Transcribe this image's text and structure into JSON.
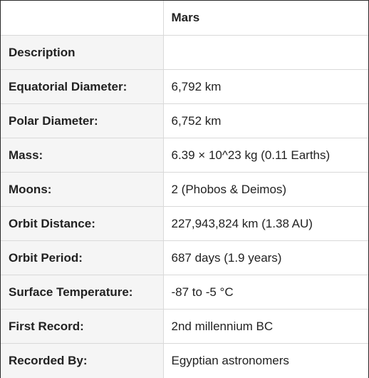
{
  "table": {
    "header": {
      "corner": "",
      "planet": "Mars"
    },
    "rows": [
      {
        "label": "Description",
        "value": ""
      },
      {
        "label": "Equatorial Diameter:",
        "value": "6,792 km"
      },
      {
        "label": "Polar Diameter:",
        "value": "6,752 km"
      },
      {
        "label": "Mass:",
        "value": "6.39 × 10^23 kg (0.11 Earths)"
      },
      {
        "label": "Moons:",
        "value": "2 (Phobos & Deimos)"
      },
      {
        "label": "Orbit Distance:",
        "value": "227,943,824 km (1.38 AU)"
      },
      {
        "label": "Orbit Period:",
        "value": "687 days (1.9 years)"
      },
      {
        "label": "Surface Temperature:",
        "value": "-87 to -5 °C"
      },
      {
        "label": "First Record:",
        "value": "2nd millennium BC"
      },
      {
        "label": "Recorded By:",
        "value": "Egyptian astronomers"
      }
    ]
  }
}
